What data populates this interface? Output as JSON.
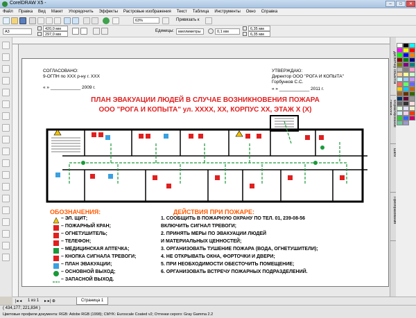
{
  "window": {
    "title": "CorelDRAW X5 -",
    "minimize": "–",
    "maximize": "□",
    "close": "✕"
  },
  "menu": [
    "Файл",
    "Правка",
    "Вид",
    "Макет",
    "Упорядочить",
    "Эффекты",
    "Растровые изображения",
    "Текст",
    "Таблица",
    "Инструменты",
    "Окно",
    "Справка"
  ],
  "property_bar": {
    "paper": "A3",
    "width": "420,0 мм",
    "height": "297,0 мм",
    "zoom": "63%",
    "snap": "Привязать к",
    "units_label": "Единицы:",
    "units": "миллиметры",
    "nudge": "0,1 мм",
    "dup_x": "6,35 мм",
    "dup_y": "6,35 мм"
  },
  "document": {
    "approved_label": "СОГЛАСОВАНО:",
    "approved_org": "9-ОГПН по ХХХ р-ну г. ХХХ",
    "approved_date": "«  »  ____________ 2009 г.",
    "confirm_label": "УТВЕРЖДАЮ:",
    "confirm_org": "Директор ООО \"РОГА И КОПЫТА\"",
    "confirm_name": "Горбунков С.С.",
    "confirm_date": "«  »  ____________ 2011 г.",
    "title_line1": "ПЛАН ЭВАКУАЦИИ ЛЮДЕЙ В СЛУЧАЕ ВОЗНИКНОВЕНИЯ ПОЖАРА",
    "title_line2": "ООО \"РОГА И КОПЫТА\" ул. ХХХХ, ХХ, КОРПУС ХХ, ЭТАЖ Х (Х)",
    "legend_title": "ОБОЗНАЧЕНИЯ:",
    "legend": [
      "– ЭЛ. ЩИТ;",
      "– ПОЖАРНЫЙ КРАН;",
      "– ОГНЕТУШИТЕЛЬ;",
      "– ТЕЛЕФОН;",
      "– МЕДИЦИНСКАЯ АПТЕЧКА;",
      "– КНОПКА СИГНАЛА ТРЕВОГИ;",
      "– ПЛАН ЭВАКУАЦИИ;",
      "– ОСНОВНОЙ ВЫХОД;",
      "– ЗАПАСНОЙ ВЫХОД."
    ],
    "actions_title": "ДЕЙСТВИЯ  ПРИ  ПОЖАРЕ:",
    "actions": [
      "1. СООБЩИТЬ В ПОЖАРНУЮ ОХРАНУ ПО ТЕЛ. 01, 239-08-56",
      "    ВКЛЮЧИТЬ СИГНАЛ ТРЕВОГИ;",
      "2. ПРИНЯТЬ МЕРЫ ПО ЭВАКУАЦИИ ЛЮДЕЙ",
      "    И МАТЕРИАЛЬНЫХ ЦЕННОСТЕЙ;",
      "3. ОРГАНИЗОВАТЬ ТУШЕНИЕ ПОЖАРА (ВОДА, ОГНЕТУШИТЕЛИ);",
      "4. НЕ ОТКРЫВАТЬ ОКНА, ФОРТОЧКИ И ДВЕРИ;",
      "5. ПРИ НЕОБХОДИМОСТИ ОБЕСТОЧИТЬ ПОМЕЩЕНИЕ;",
      "6. ОРГАНИЗОВАТЬ ВСТРЕЧУ ПОЖАРНЫХ ПОДРАЗДЕЛЕНИЙ."
    ]
  },
  "page_nav": {
    "counter": "1 из 1",
    "tab": "Страница 1"
  },
  "status": {
    "coords": "( 434,177; 221,834 )",
    "profiles": "Цветовые профили документа: RGB: Adobe RGB (1998); CMYK: Euroscale Coated v2; Оттенки серого: Gray Gamma 2.2"
  },
  "dockers": [
    "Диспетчер объектов",
    "Форматирование символов",
    "Шаги",
    "Преобразования"
  ],
  "colors": {
    "accent_red": "#e02020",
    "accent_orange": "#ff5a00",
    "route_green": "#1a9a3a"
  }
}
